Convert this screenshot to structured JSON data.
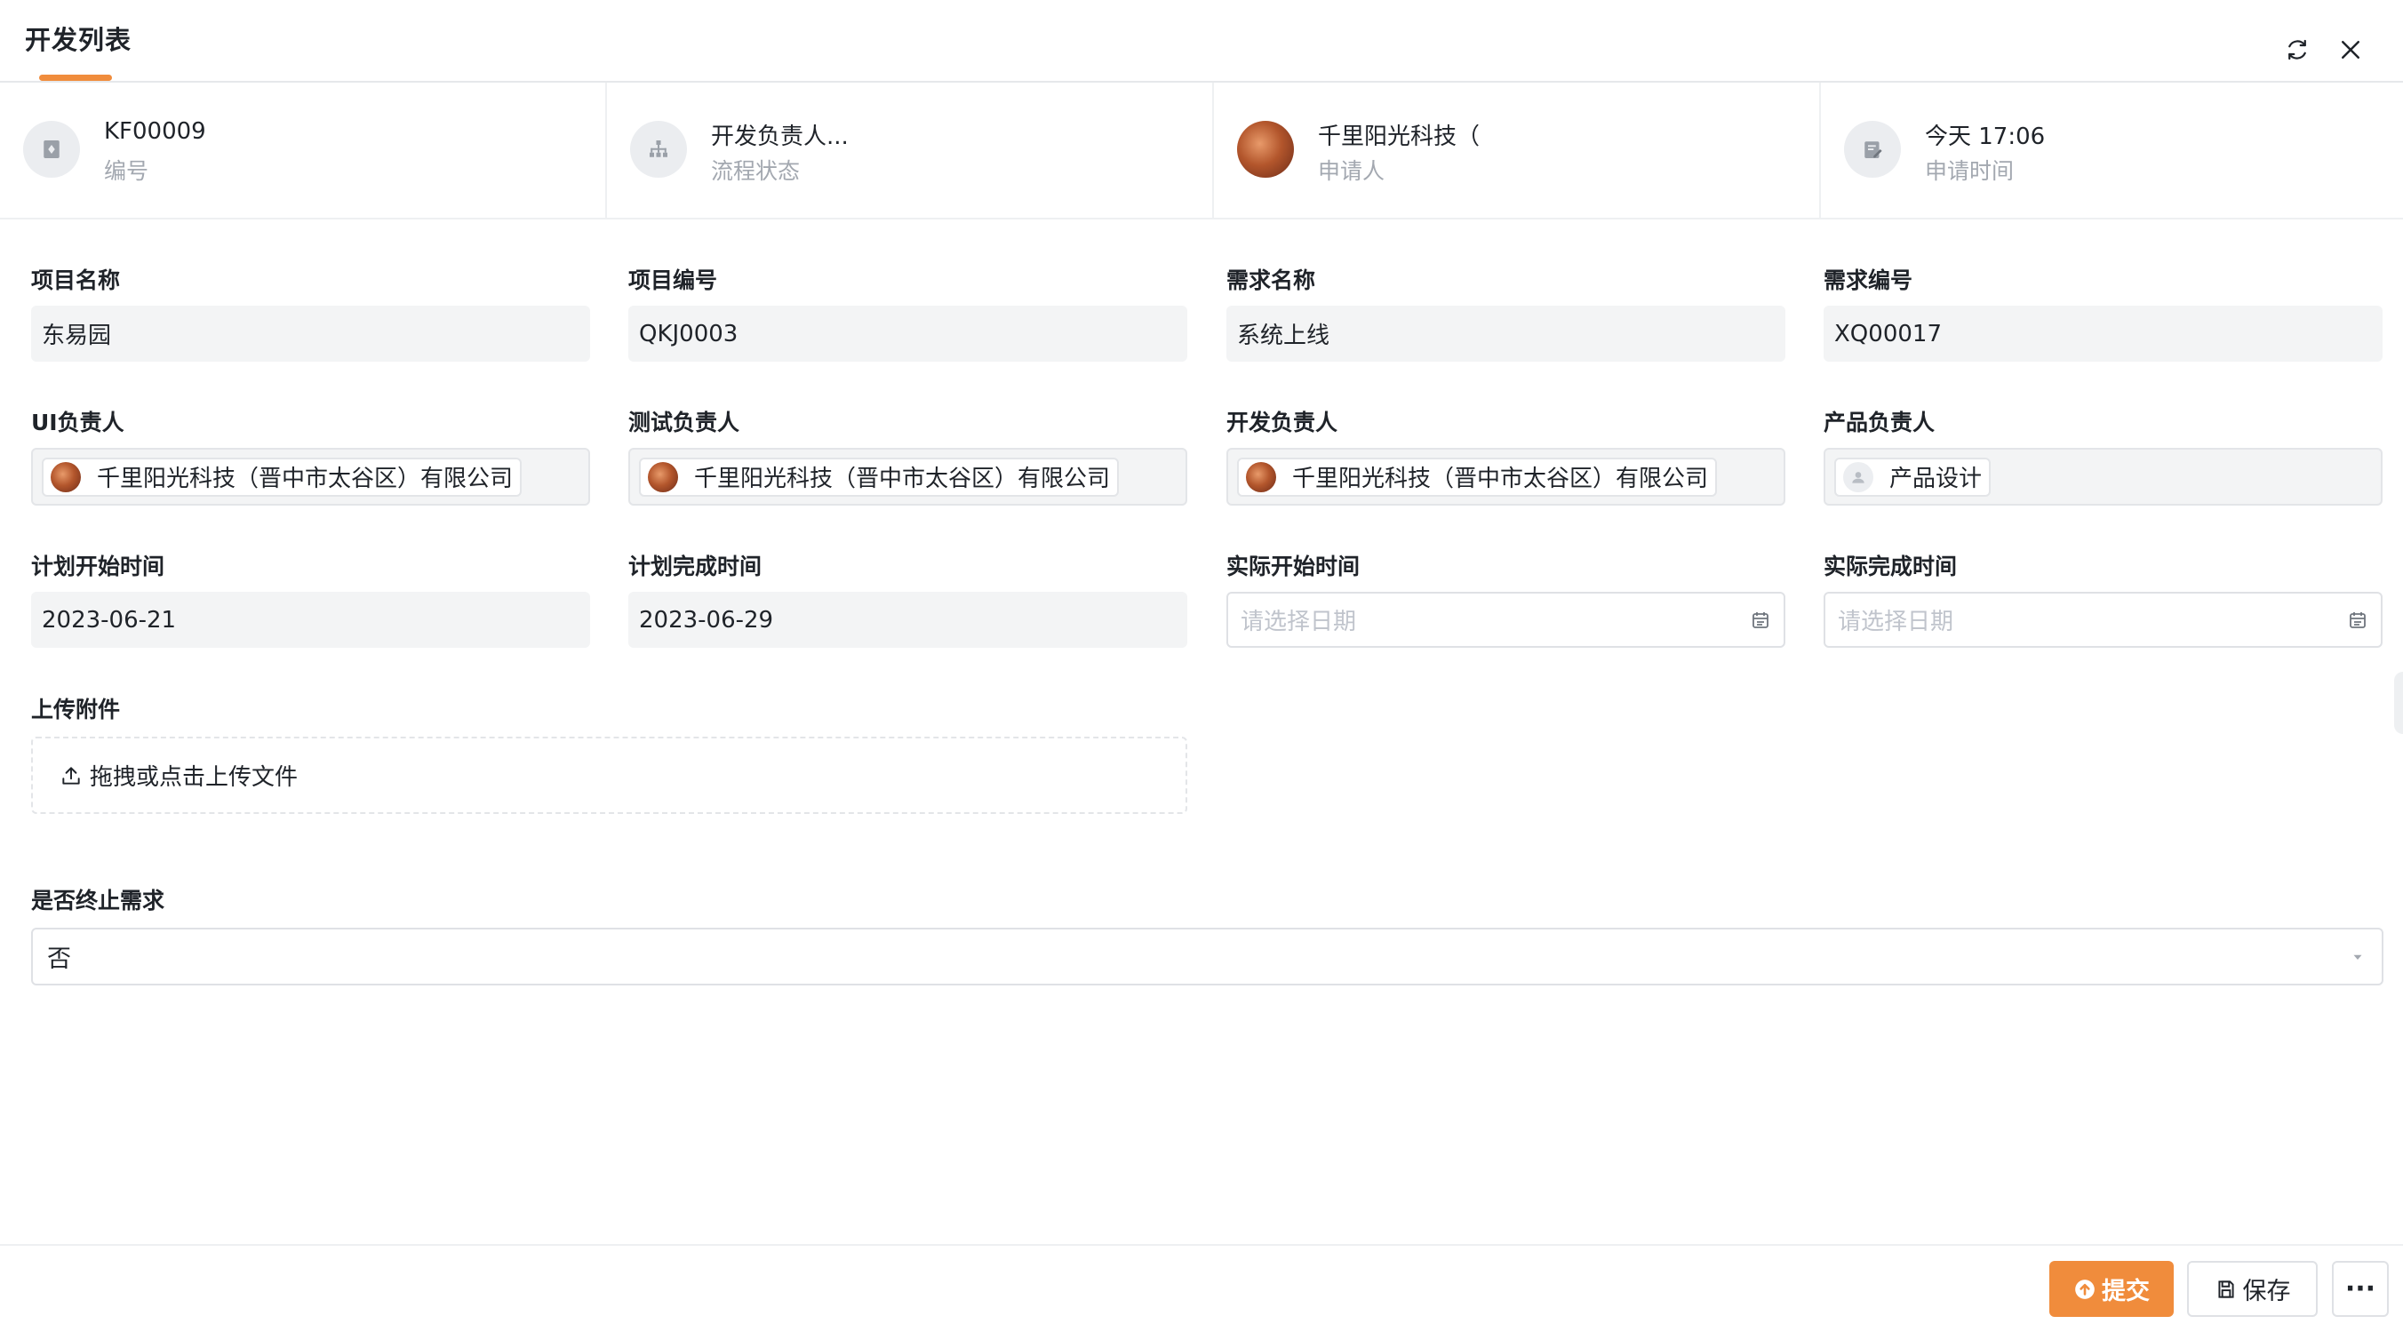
{
  "header": {
    "title": "开发列表"
  },
  "info": {
    "number_value": "KF00009",
    "number_label": "编号",
    "status_value": "开发负责人...",
    "status_label": "流程状态",
    "applicant_value": "千里阳光科技（",
    "applicant_label": "申请人",
    "time_value": "今天 17:06",
    "time_label": "申请时间"
  },
  "form": {
    "project_name": {
      "label": "项目名称",
      "value": "东易园"
    },
    "project_code": {
      "label": "项目编号",
      "value": "QKJ0003"
    },
    "req_name": {
      "label": "需求名称",
      "value": "系统上线"
    },
    "req_code": {
      "label": "需求编号",
      "value": "XQ00017"
    },
    "ui_owner": {
      "label": "UI负责人",
      "value": "千里阳光科技（晋中市太谷区）有限公司"
    },
    "test_owner": {
      "label": "测试负责人",
      "value": "千里阳光科技（晋中市太谷区）有限公司"
    },
    "dev_owner": {
      "label": "开发负责人",
      "value": "千里阳光科技（晋中市太谷区）有限公司"
    },
    "product_owner": {
      "label": "产品负责人",
      "value": "产品设计"
    },
    "plan_start": {
      "label": "计划开始时间",
      "value": "2023-06-21"
    },
    "plan_end": {
      "label": "计划完成时间",
      "value": "2023-06-29"
    },
    "actual_start": {
      "label": "实际开始时间",
      "placeholder": "请选择日期"
    },
    "actual_end": {
      "label": "实际完成时间",
      "placeholder": "请选择日期"
    },
    "upload": {
      "label": "上传附件",
      "text": "拖拽或点击上传文件"
    },
    "terminate": {
      "label": "是否终止需求",
      "value": "否"
    }
  },
  "footer": {
    "submit_label": "提交",
    "save_label": "保存",
    "more_label": "···"
  },
  "colors": {
    "accent": "#f08c3c",
    "field_bg": "#f3f4f5",
    "muted_text": "#a3a8b0"
  }
}
